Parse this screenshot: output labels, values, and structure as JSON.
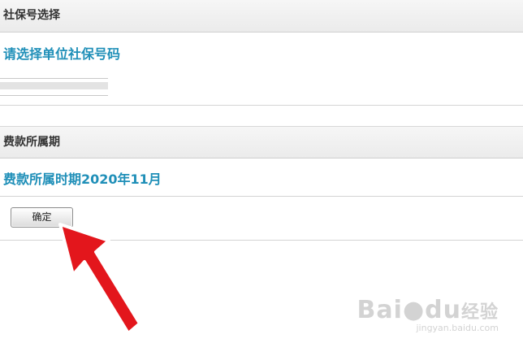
{
  "social_section": {
    "header": "社保号选择",
    "title": "请选择单位社保号码"
  },
  "period_section": {
    "header": "费款所属期",
    "title": "费款所属时期2020年11月"
  },
  "confirm_button": {
    "label": "确定"
  },
  "watermark": {
    "brand_latin": "Bai",
    "brand_rest": "du",
    "brand_cn": "经验",
    "url": "jingyan.baidu.com"
  },
  "colors": {
    "accent_blue": "#1f8fb8",
    "arrow_red": "#e3161c"
  },
  "icons": [
    "red-arrow-icon",
    "baidu-paw-icon"
  ]
}
